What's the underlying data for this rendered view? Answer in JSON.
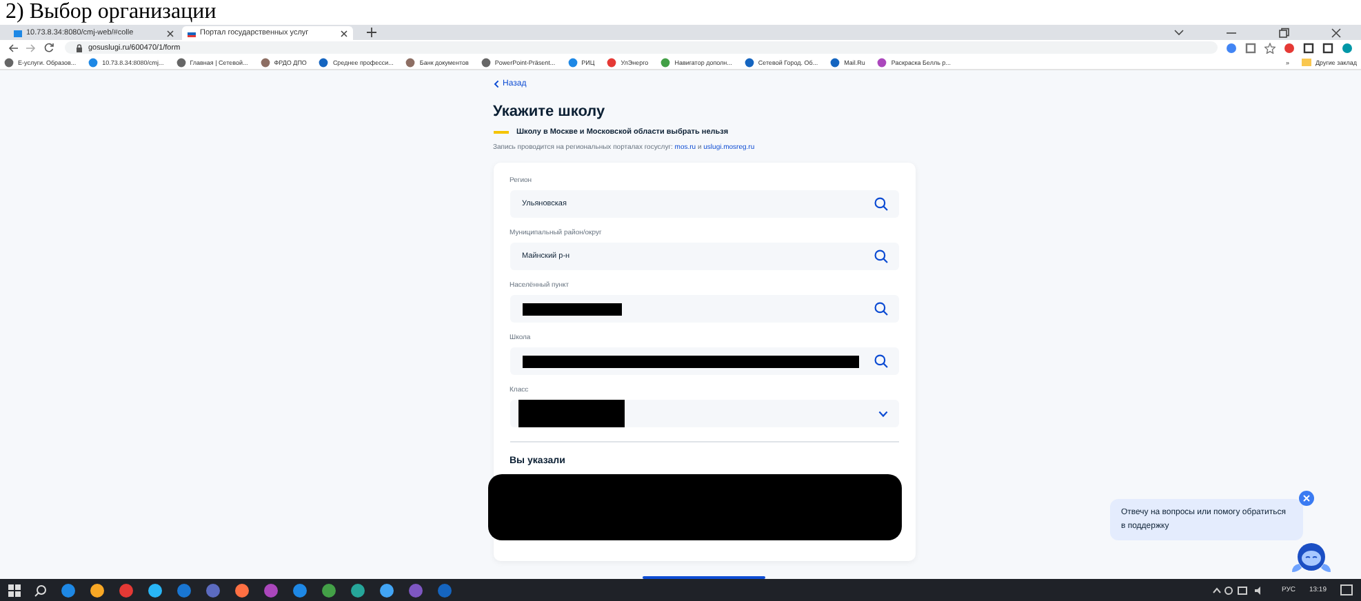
{
  "caption": "2) Выбор организации",
  "browser": {
    "tabs": [
      {
        "title": "10.73.8.34:8080/cmj-web/#colle",
        "selected": false
      },
      {
        "title": "Портал государственных услуг",
        "selected": true
      }
    ],
    "url": "gosuslugi.ru/600470/1/form",
    "bookmarks": [
      "E-услуги. Образов...",
      "10.73.8.34:8080/cmj...",
      "Главная | Сетевой...",
      "ФРДО ДПО",
      "Среднее професси...",
      "Банк документов",
      "PowerPoint-Präsent...",
      "РИЦ",
      "УлЭнерго",
      "Навигатор дополн...",
      "Сетевой Город. Об...",
      "Mail.Ru",
      "Раскраска Белль р..."
    ],
    "more_bookmarks": "»",
    "other_bookmarks": "Другие заклад"
  },
  "page": {
    "back": "Назад",
    "title": "Укажите школу",
    "warning": "Школу в Москве и Московской области выбрать нельзя",
    "note": {
      "text": "Запись проводится на региональных порталах госуслуг:",
      "link_1": "mos.ru",
      "joiner": "и",
      "link_2": "uslugi.mosreg.ru"
    },
    "fields": [
      {
        "label": "Регион",
        "value": "Ульяновская",
        "kind": "search",
        "redacted": false
      },
      {
        "label": "Муниципальный район/округ",
        "value": "Майнский р-н",
        "kind": "search",
        "redacted": false
      },
      {
        "label": "Населённый пункт",
        "kind": "search",
        "redacted": true
      },
      {
        "label": "Школа",
        "kind": "search",
        "redacted": true
      },
      {
        "label": "Класс",
        "kind": "dropdown",
        "redacted": true
      }
    ],
    "summary_title": "Вы указали"
  },
  "assistant": {
    "message": "Отвечу на вопросы или помогу обратиться в поддержку"
  },
  "taskbar": {
    "language": "РУС",
    "time": "13:19"
  }
}
